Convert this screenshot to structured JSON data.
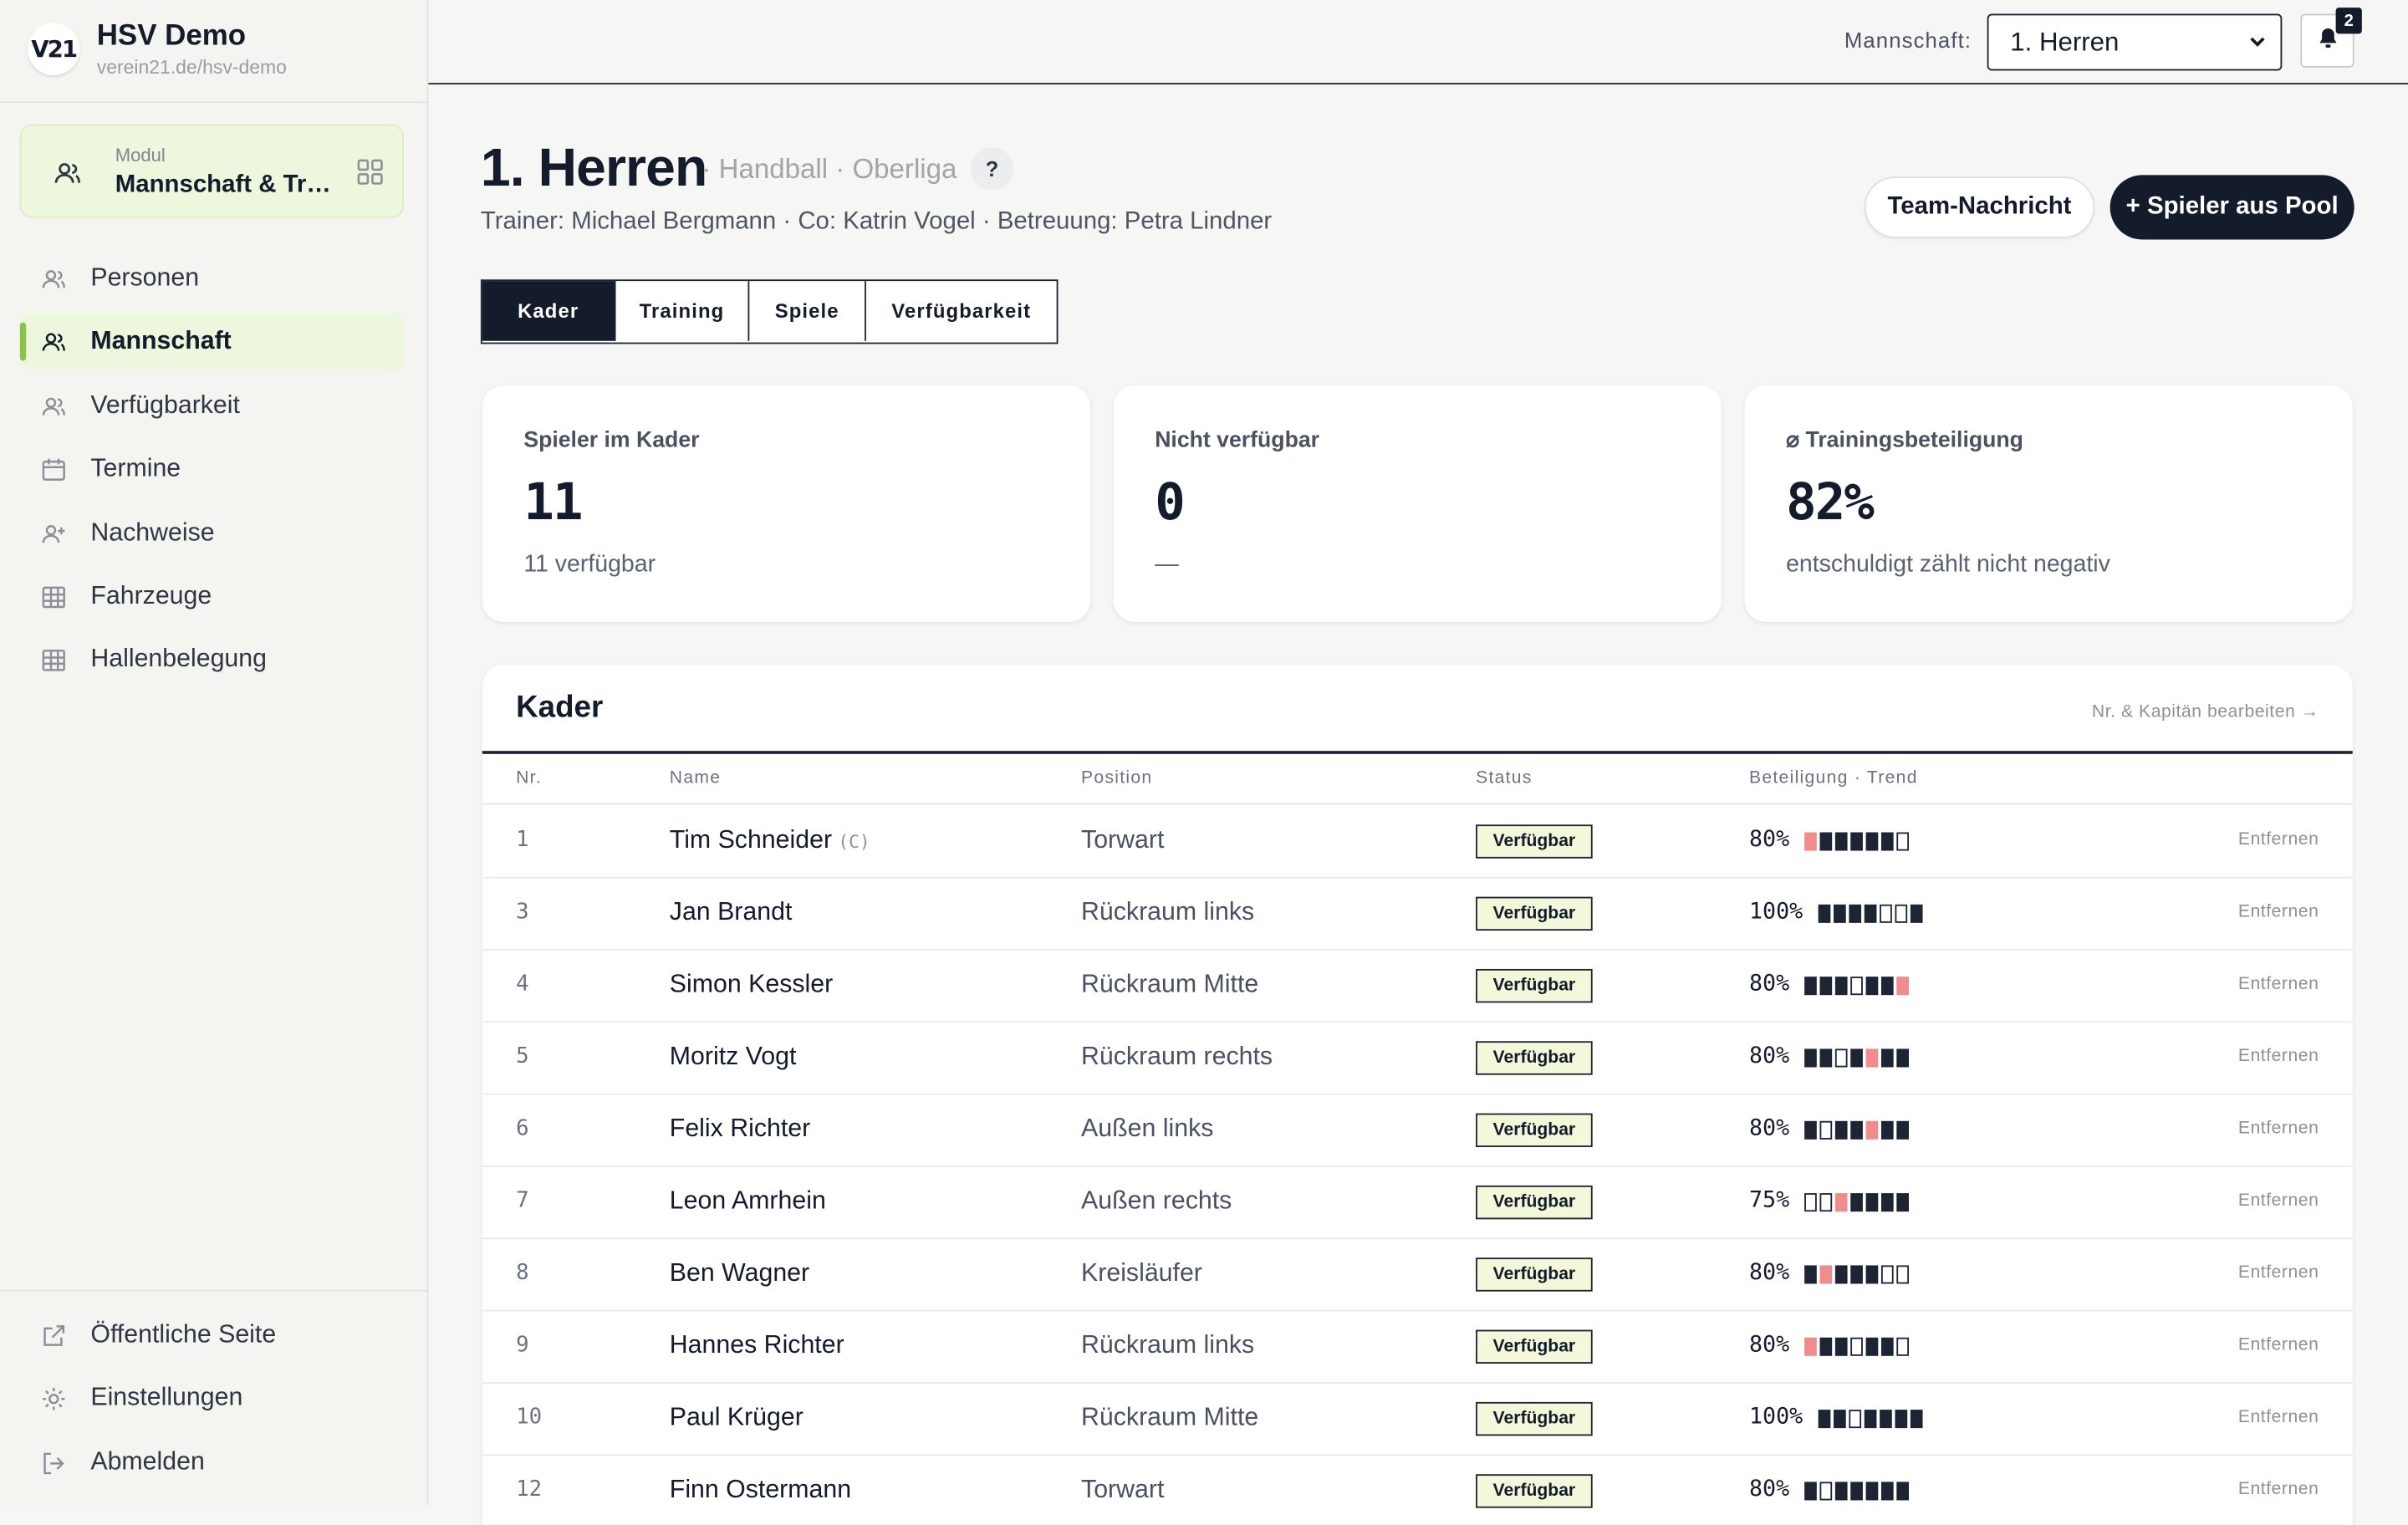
{
  "app": {
    "name": "HSV Demo",
    "url": "verein21.de/hsv-demo",
    "logo_text": "V21"
  },
  "module": {
    "label": "Modul",
    "name": "Mannschaft & Training"
  },
  "nav": [
    {
      "label": "Personen",
      "icon": "users-icon",
      "active": false
    },
    {
      "label": "Mannschaft",
      "icon": "users-icon",
      "active": true
    },
    {
      "label": "Verfügbarkeit",
      "icon": "users-icon",
      "active": false
    },
    {
      "label": "Termine",
      "icon": "calendar-icon",
      "active": false
    },
    {
      "label": "Nachweise",
      "icon": "user-plus-icon",
      "active": false
    },
    {
      "label": "Fahrzeuge",
      "icon": "table-icon",
      "active": false
    },
    {
      "label": "Hallenbelegung",
      "icon": "table-icon",
      "active": false
    }
  ],
  "footer_nav": [
    {
      "label": "Öffentliche Seite",
      "icon": "external-link-icon"
    },
    {
      "label": "Einstellungen",
      "icon": "gear-icon"
    },
    {
      "label": "Abmelden",
      "icon": "logout-icon"
    }
  ],
  "header": {
    "team_label": "Mannschaft:",
    "team_value": "1. Herren",
    "notification_count": "2"
  },
  "page": {
    "title": "1. Herren",
    "subtitle": "· Handball · Oberliga",
    "help": "?",
    "staff": "Trainer: Michael Bergmann · Co: Katrin Vogel · Betreuung: Petra Lindner",
    "btn_message": "Team-Nachricht",
    "btn_add": "+ Spieler aus Pool"
  },
  "tabs": [
    "Kader",
    "Training",
    "Spiele",
    "Verfügbarkeit"
  ],
  "stats": [
    {
      "label": "Spieler im Kader",
      "value": "11",
      "sub": "11 verfügbar"
    },
    {
      "label": "Nicht verfügbar",
      "value": "0",
      "sub": "—"
    },
    {
      "label": "⌀ Trainingsbeteiligung",
      "value": "82%",
      "sub": "entschuldigt zählt nicht negativ"
    }
  ],
  "roster": {
    "title": "Kader",
    "edit_link": "Nr. & Kapitän bearbeiten →",
    "columns": [
      "Nr.",
      "Name",
      "Position",
      "Status",
      "Beteiligung · Trend"
    ],
    "remove_label": "Entfernen",
    "rows": [
      {
        "nr": "1",
        "name": "Tim Schneider",
        "captain": "(C)",
        "position": "Torwart",
        "status": "Verfügbar",
        "pct": "80%",
        "trend": "rfffffe"
      },
      {
        "nr": "3",
        "name": "Jan Brandt",
        "captain": "",
        "position": "Rückraum links",
        "status": "Verfügbar",
        "pct": "100%",
        "trend": "ffffeef"
      },
      {
        "nr": "4",
        "name": "Simon Kessler",
        "captain": "",
        "position": "Rückraum Mitte",
        "status": "Verfügbar",
        "pct": "80%",
        "trend": "fffeffr"
      },
      {
        "nr": "5",
        "name": "Moritz Vogt",
        "captain": "",
        "position": "Rückraum rechts",
        "status": "Verfügbar",
        "pct": "80%",
        "trend": "ffefrff"
      },
      {
        "nr": "6",
        "name": "Felix Richter",
        "captain": "",
        "position": "Außen links",
        "status": "Verfügbar",
        "pct": "80%",
        "trend": "feffrff"
      },
      {
        "nr": "7",
        "name": "Leon Amrhein",
        "captain": "",
        "position": "Außen rechts",
        "status": "Verfügbar",
        "pct": "75%",
        "trend": "eerffff"
      },
      {
        "nr": "8",
        "name": "Ben Wagner",
        "captain": "",
        "position": "Kreisläufer",
        "status": "Verfügbar",
        "pct": "80%",
        "trend": "frfffee"
      },
      {
        "nr": "9",
        "name": "Hannes Richter",
        "captain": "",
        "position": "Rückraum links",
        "status": "Verfügbar",
        "pct": "80%",
        "trend": "rffeffe"
      },
      {
        "nr": "10",
        "name": "Paul Krüger",
        "captain": "",
        "position": "Rückraum Mitte",
        "status": "Verfügbar",
        "pct": "100%",
        "trend": "ffeffff"
      },
      {
        "nr": "12",
        "name": "Finn Ostermann",
        "captain": "",
        "position": "Torwart",
        "status": "Verfügbar",
        "pct": "80%",
        "trend": "fefffff"
      }
    ]
  }
}
